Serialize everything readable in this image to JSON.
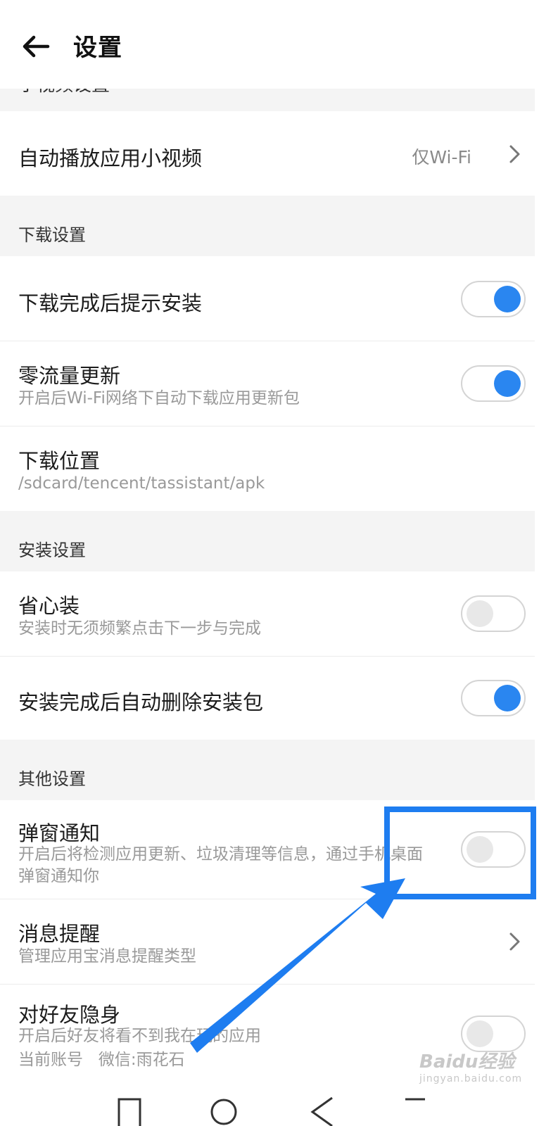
{
  "header": {
    "title": "设置",
    "back_icon": "arrow-left-icon"
  },
  "partial_section": {
    "label": "小视频设置"
  },
  "rows": {
    "autoplay": {
      "title": "自动播放应用小视频",
      "value": "仅Wi-Fi"
    },
    "download_section": "下载设置",
    "prompt_install": {
      "title": "下载完成后提示安装",
      "enabled": true
    },
    "zero_traffic": {
      "title": "零流量更新",
      "subtitle": "开启后Wi-Fi网络下自动下载应用更新包",
      "enabled": true
    },
    "download_location": {
      "title": "下载位置",
      "subtitle": "/sdcard/tencent/tassistant/apk"
    },
    "install_section": "安装设置",
    "easy_install": {
      "title": "省心装",
      "subtitle": "安装时无须频繁点击下一步与完成",
      "enabled": false
    },
    "auto_delete": {
      "title": "安装完成后自动删除安装包",
      "enabled": true
    },
    "other_section": "其他设置",
    "popup_notify": {
      "title": "弹窗通知",
      "subtitle": "开启后将检测应用更新、垃圾清理等信息，通过手机桌面弹窗通知你",
      "enabled": false
    },
    "message_reminder": {
      "title": "消息提醒",
      "subtitle": "管理应用宝消息提醒类型"
    },
    "invisible": {
      "title": "对好友隐身",
      "subtitle_line1": "开启后好友将看不到我在玩的应用",
      "subtitle_line2": "当前账号   微信:雨花石",
      "enabled": false
    }
  },
  "watermark": {
    "brand": "Baidu经验",
    "url": "jingyan.baidu.com"
  },
  "colors": {
    "accent": "#2a86f0",
    "highlight": "#1e7df0",
    "section_bg": "#f4f4f4"
  }
}
